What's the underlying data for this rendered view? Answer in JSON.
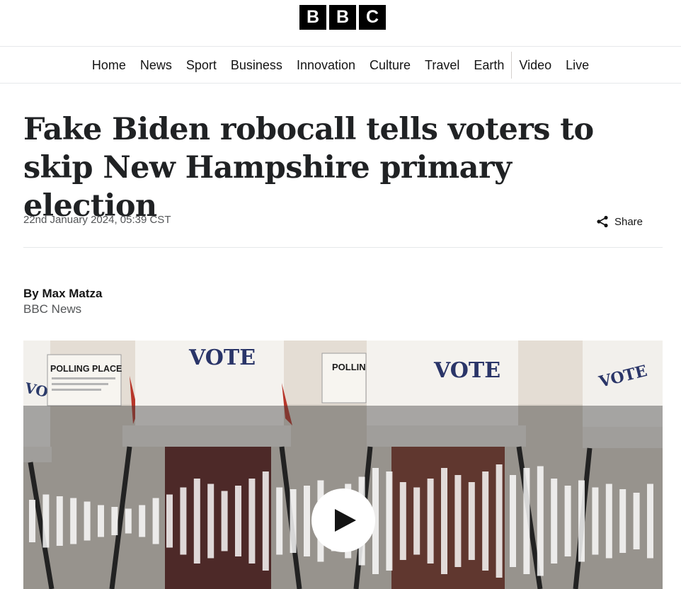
{
  "brand": {
    "letters": [
      "B",
      "B",
      "C"
    ]
  },
  "nav": {
    "items": [
      "Home",
      "News",
      "Sport",
      "Business",
      "Innovation",
      "Culture",
      "Travel",
      "Earth"
    ],
    "items_after_divider": [
      "Video",
      "Live"
    ]
  },
  "article": {
    "headline": "Fake Biden robocall tells voters to skip New Hampshire primary election",
    "timestamp": "22nd January 2024, 05:39 CST",
    "share_label": "Share",
    "author": "By Max Matza",
    "organization": "BBC News"
  },
  "media": {
    "signs": {
      "vote": "VOTE",
      "polling_place": "POLLING PLACE",
      "polling_partial": "POLLIN",
      "vote_left": "VOTE",
      "vote_right": "VOTE"
    },
    "icons": [
      "play-icon",
      "waveform"
    ],
    "colors": {
      "overlay": "#3c3c3c",
      "bars": "#ffffff"
    }
  },
  "colors": {
    "text": "#141414",
    "muted": "#545658",
    "rule": "#e6e8ea"
  }
}
